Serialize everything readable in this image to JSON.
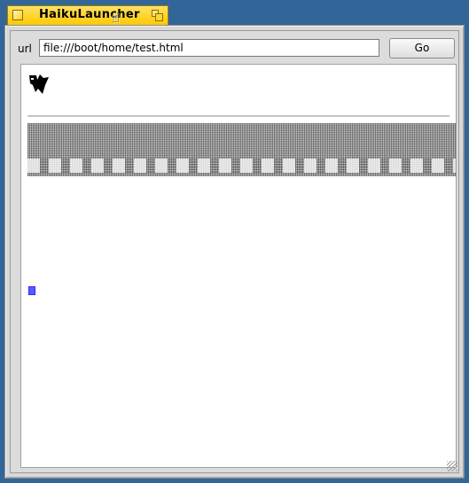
{
  "window": {
    "title": "HaikuLauncher",
    "tab_color": "#ffcb00",
    "desktop_color": "#336698"
  },
  "toolbar": {
    "url_label": "url",
    "url_value": "file:///boot/home/test.html",
    "go_label": "Go"
  },
  "icons": {
    "close": "close-box-icon",
    "zoom": "zoom-box-icon",
    "cursor": "hand-pointer-icon",
    "resize": "resize-grip-icon"
  }
}
